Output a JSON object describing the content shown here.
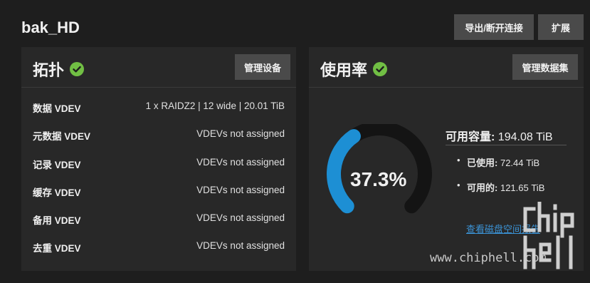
{
  "pool": {
    "name": "bak_HD"
  },
  "header_buttons": {
    "export": "导出/断开连接",
    "expand": "扩展"
  },
  "topology": {
    "title": "拓扑",
    "status_icon": "check-circle-icon",
    "manage_button": "管理设备",
    "rows": [
      {
        "label": "数据 VDEV",
        "value": "1 x RAIDZ2 | 12 wide | 20.01 TiB"
      },
      {
        "label": "元数据 VDEV",
        "value": "VDEVs not assigned"
      },
      {
        "label": "记录 VDEV",
        "value": "VDEVs not assigned"
      },
      {
        "label": "缓存 VDEV",
        "value": "VDEVs not assigned"
      },
      {
        "label": "备用 VDEV",
        "value": "VDEVs not assigned"
      },
      {
        "label": "去重 VDEV",
        "value": "VDEVs not assigned"
      }
    ]
  },
  "usage": {
    "title": "使用率",
    "status_icon": "check-circle-icon",
    "manage_button": "管理数据集",
    "percent_label": "37.3%",
    "percent_value": 37.3,
    "available_label": "可用容量:",
    "available_value": "194.08 TiB",
    "used_label": "已使用:",
    "used_value": "72.44 TiB",
    "free_label": "可用的:",
    "free_value": "121.65 TiB",
    "report_link": "查看磁盘空间报告"
  },
  "watermark": {
    "site": "www.chiphell.com"
  },
  "colors": {
    "accent": "#1d8fd4",
    "ok": "#71bf44",
    "track": "#141414",
    "card": "#282828",
    "button": "#4a4a4a"
  }
}
